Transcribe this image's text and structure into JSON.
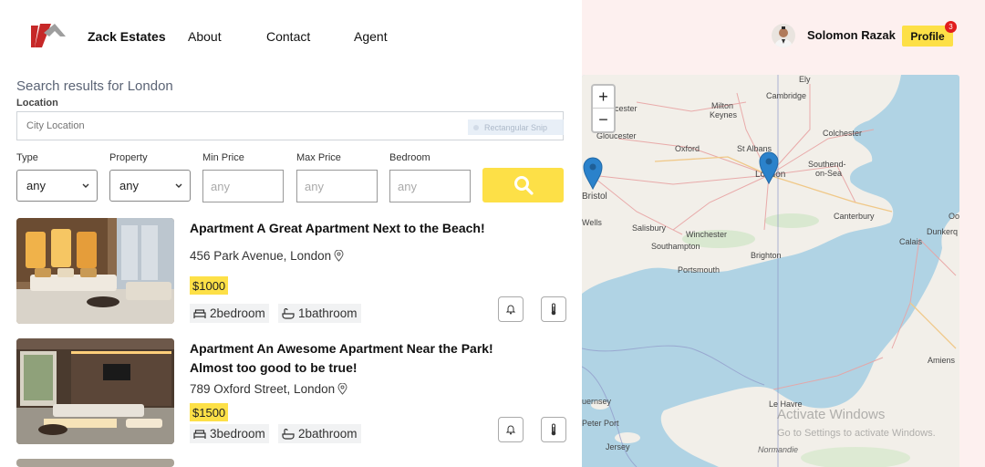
{
  "nav": {
    "brand": "Zack Estates",
    "links": [
      "About",
      "Contact",
      "Agent"
    ],
    "username": "Solomon Razak",
    "profile_label": "Profile",
    "notification_count": "3"
  },
  "search": {
    "title": "Search results for London",
    "location_label": "Location",
    "location_placeholder": "City Location",
    "snip_text": "Rectangular Snip",
    "filters": {
      "type_label": "Type",
      "type_value": "any",
      "property_label": "Property",
      "property_value": "any",
      "min_label": "Min Price",
      "min_placeholder": "any",
      "max_label": "Max Price",
      "max_placeholder": "any",
      "bed_label": "Bedroom",
      "bed_placeholder": "any"
    }
  },
  "listings": [
    {
      "title": "Apartment A Great Apartment Next to the Beach!",
      "address": "456 Park Avenue, London",
      "price": "$1000",
      "bedrooms": "2bedroom",
      "bathrooms": "1bathroom"
    },
    {
      "title_line1": "Apartment An Awesome Apartment Near the Park!",
      "title_line2": "Almost too good to be true!",
      "address": "789 Oxford Street, London",
      "price": "$1500",
      "bedrooms": "3bedroom",
      "bathrooms": "2bathroom"
    }
  ],
  "map": {
    "zoom_in": "+",
    "zoom_out": "−",
    "places": {
      "ely": "Ely",
      "cambridge": "Cambridge",
      "milton_keynes_1": "Milton",
      "milton_keynes_2": "Keynes",
      "gloucester": "Gloucester",
      "oxford": "Oxford",
      "st_albans": "St Albans",
      "colchester": "Colchester",
      "london": "London",
      "southend_1": "Southend-",
      "southend_2": "on-Sea",
      "bristol": "Bristol",
      "wells": "Wells",
      "salisbury": "Salisbury",
      "winchester": "Winchester",
      "canterbury": "Canterbury",
      "southampton": "Southampton",
      "calais": "Calais",
      "dunkerque": "Dunkerq",
      "portsmouth": "Portsmouth",
      "brighton": "Brighton",
      "amiens": "Amiens",
      "guernsey": "uernsey",
      "peter_port": "Peter Port",
      "le_havre": "Le Havre",
      "jersey": "Jersey",
      "normandie": "Normandie",
      "oos": "Oos",
      "cester": "cester"
    },
    "watermark_title": "Activate Windows",
    "watermark_sub": "Go to Settings to activate Windows."
  }
}
